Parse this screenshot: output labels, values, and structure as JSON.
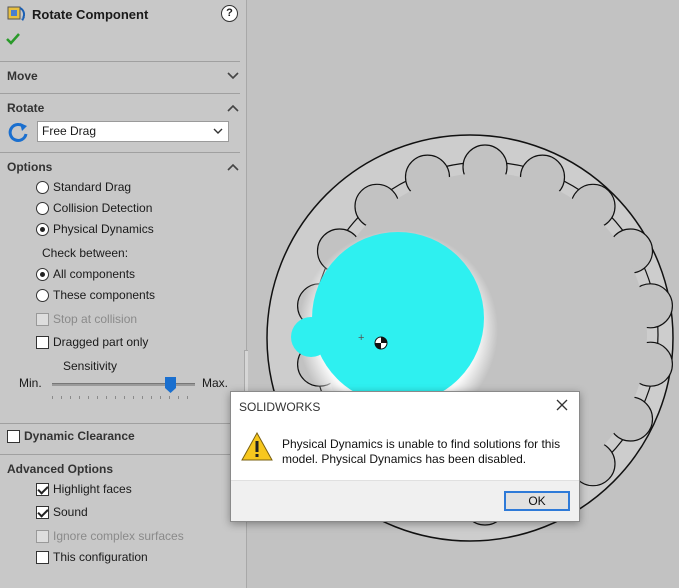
{
  "panel": {
    "title": "Rotate Component",
    "help": "?",
    "sections": {
      "move": "Move",
      "rotate": "Rotate",
      "options": "Options",
      "dynamic_clearance": "Dynamic Clearance",
      "advanced": "Advanced Options"
    },
    "rotate_mode": "Free Drag",
    "options": {
      "standard_drag": "Standard Drag",
      "collision_detection": "Collision Detection",
      "physical_dynamics": "Physical Dynamics",
      "check_between": "Check between:",
      "all_components": "All components",
      "these_components": "These components",
      "stop_at_collision": "Stop at collision",
      "dragged_part_only": "Dragged part only",
      "sensitivity": "Sensitivity",
      "min": "Min.",
      "max": "Max.",
      "sensitivity_level": 0.83
    },
    "advanced": {
      "highlight_faces": "Highlight faces",
      "sound": "Sound",
      "ignore_complex_surfaces": "Ignore complex surfaces",
      "this_configuration": "This configuration"
    }
  },
  "dialog": {
    "title": "SOLIDWORKS",
    "message": "Physical Dynamics is unable to find solutions for this model.  Physical Dynamics has been disabled.",
    "ok_label": "OK"
  },
  "colors": {
    "highlight_part": "#2ef0f0",
    "dialog_accent": "#2e7ad8",
    "check_green": "#2a9a2a"
  }
}
